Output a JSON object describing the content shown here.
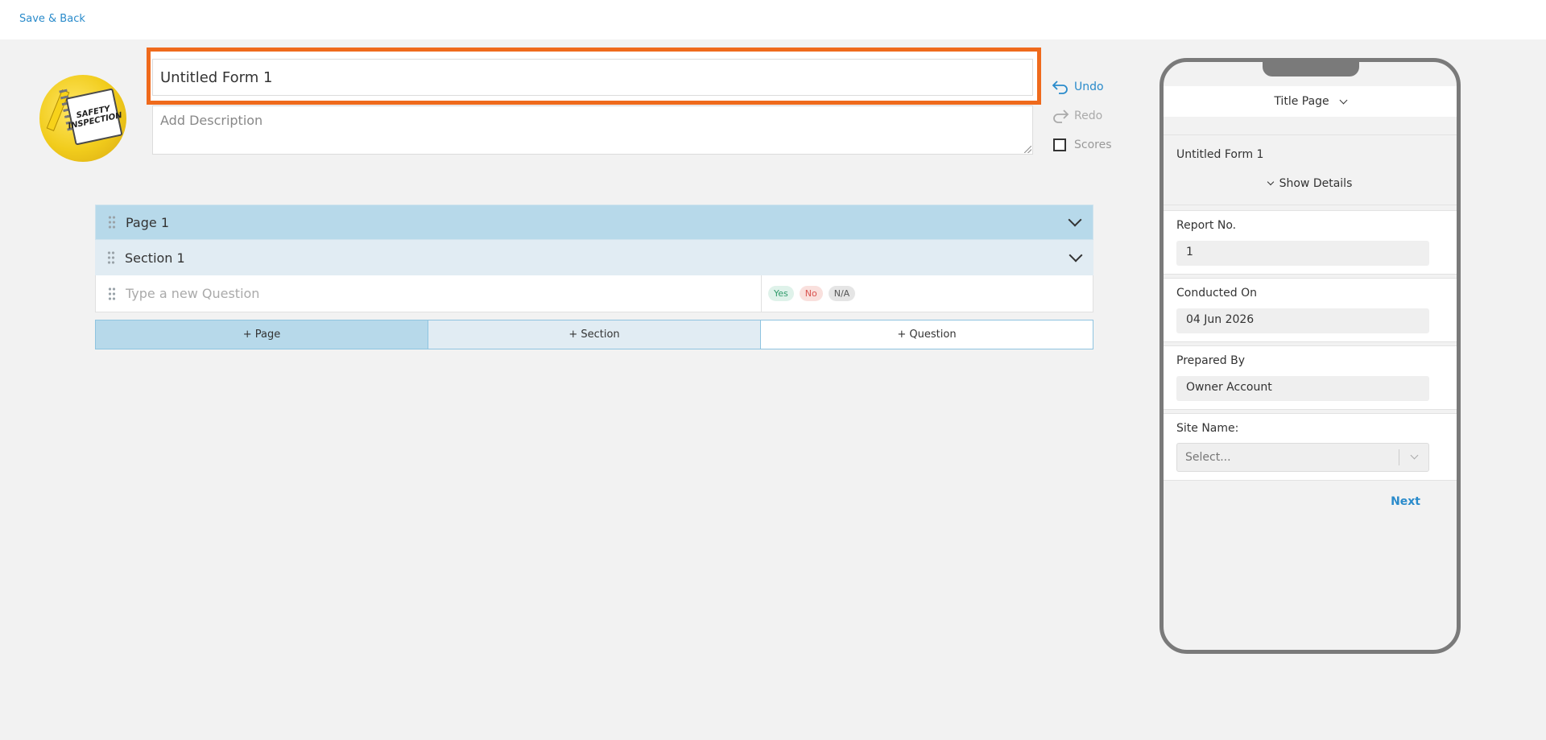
{
  "topbar": {
    "save_back": "Save & Back"
  },
  "logo": {
    "text": "SAFETY INSPECTION"
  },
  "form": {
    "title_value": "Untitled Form 1",
    "description_placeholder": "Add Description"
  },
  "actions": {
    "undo": "Undo",
    "redo": "Redo",
    "scores": "Scores"
  },
  "builder": {
    "page_title": "Page 1",
    "section_title": "Section 1",
    "question_placeholder": "Type a new Question",
    "responses": [
      "Yes",
      "No",
      "N/A"
    ]
  },
  "add_bar": {
    "page": "+ Page",
    "section": "+ Section",
    "question": "+ Question"
  },
  "preview": {
    "page_selector": "Title Page",
    "form_title": "Untitled Form 1",
    "show_details": "Show Details",
    "fields": [
      {
        "label": "Report No.",
        "value": "1"
      },
      {
        "label": "Conducted On",
        "value": "04 Jun 2026"
      },
      {
        "label": "Prepared By",
        "value": "Owner Account"
      }
    ],
    "site_label": "Site Name:",
    "site_placeholder": "Select...",
    "next": "Next"
  },
  "colors": {
    "accent": "#2a8bcb",
    "highlight": "#ef6a1c",
    "page_row": "#b7d9ea",
    "section_row": "#e1ecf3"
  }
}
